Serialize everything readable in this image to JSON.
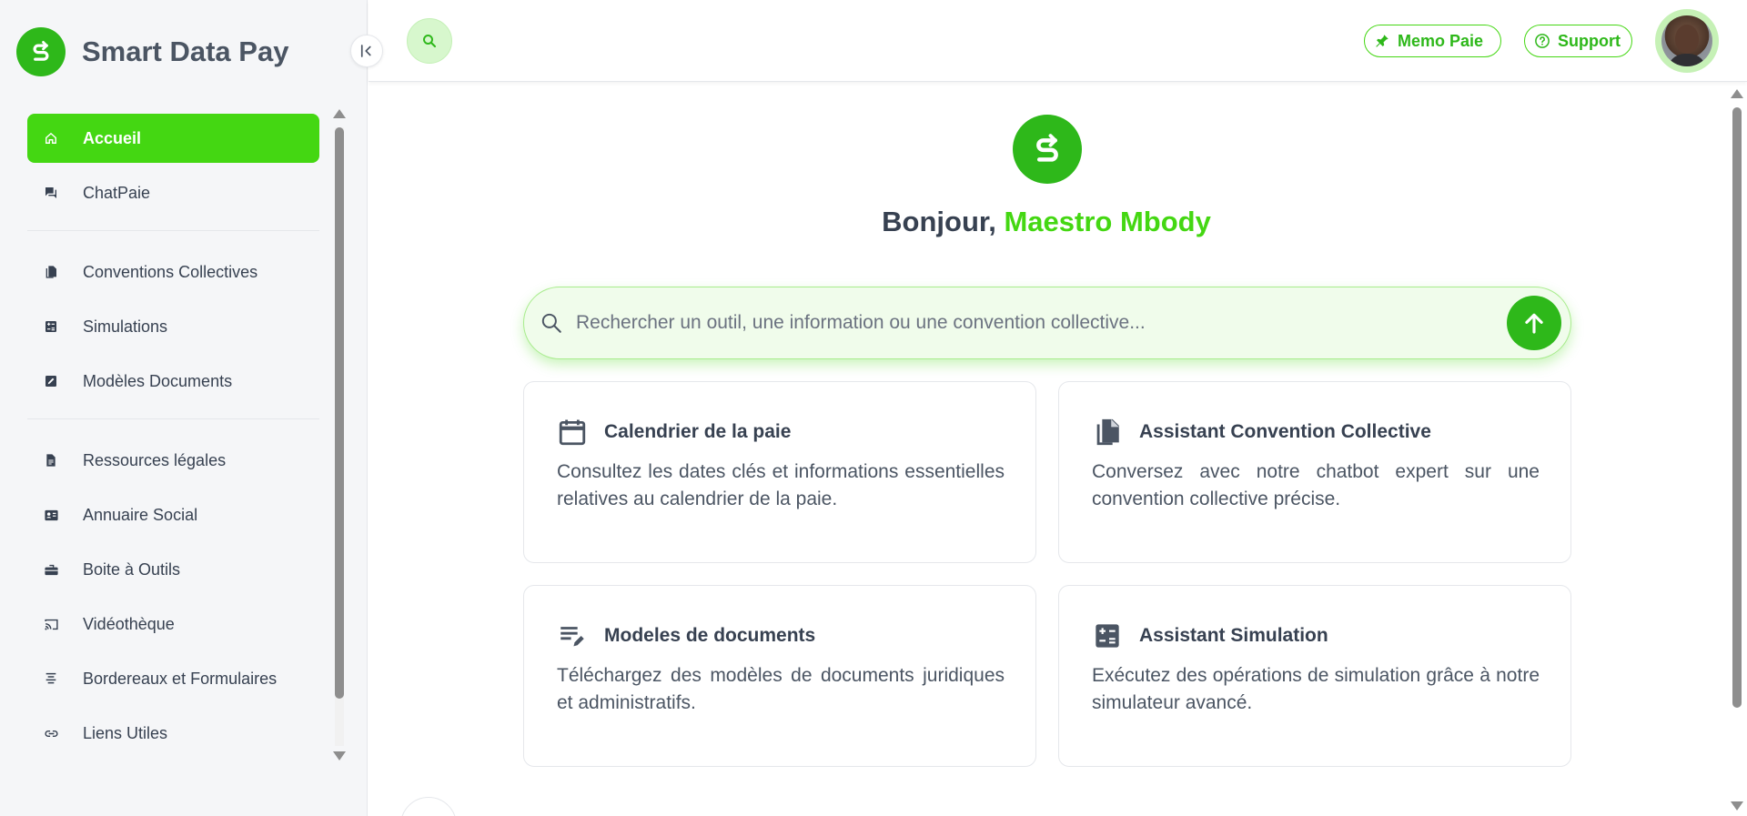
{
  "brand": {
    "name": "Smart Data Pay"
  },
  "sidebar": {
    "items": [
      {
        "label": "Accueil",
        "icon": "home-icon",
        "active": true
      },
      {
        "label": "ChatPaie",
        "icon": "chat-icon"
      },
      {
        "label": "Conventions Collectives",
        "icon": "documents-icon"
      },
      {
        "label": "Simulations",
        "icon": "calculator-icon"
      },
      {
        "label": "Modèles Documents",
        "icon": "edit-document-icon"
      },
      {
        "label": "Ressources légales",
        "icon": "file-icon"
      },
      {
        "label": "Annuaire Social",
        "icon": "contact-card-icon"
      },
      {
        "label": "Boite à Outils",
        "icon": "toolbox-icon"
      },
      {
        "label": "Vidéothèque",
        "icon": "cast-icon"
      },
      {
        "label": "Bordereaux et Formulaires",
        "icon": "list-icon"
      },
      {
        "label": "Liens Utiles",
        "icon": "link-icon"
      }
    ]
  },
  "header": {
    "memo_label": "Memo Paie",
    "support_label": "Support"
  },
  "main": {
    "greeting_prefix": "Bonjour,",
    "user_name": "Maestro Mbody",
    "search_placeholder": "Rechercher un outil, une information ou une convention collective...",
    "cards": [
      {
        "title": "Calendrier de la paie",
        "description": "Consultez les dates clés et informations essentielles relatives au calendrier de la paie.",
        "icon": "calendar-icon"
      },
      {
        "title": "Assistant Convention Collective",
        "description": "Conversez avec notre chatbot expert sur une convention collective précise.",
        "icon": "documents-icon"
      },
      {
        "title": "Modeles de documents",
        "description": "Téléchargez des modèles de documents juridiques et administratifs.",
        "icon": "edit-list-icon"
      },
      {
        "title": "Assistant Simulation",
        "description": "Exécutez des opérations de simulation grâce à notre simulateur avancé.",
        "icon": "calculator-icon"
      }
    ]
  },
  "colors": {
    "accent": "#44d712",
    "accent_dark": "#2eb81a",
    "text": "#374151",
    "sidebar_bg": "#f5f6f8"
  }
}
